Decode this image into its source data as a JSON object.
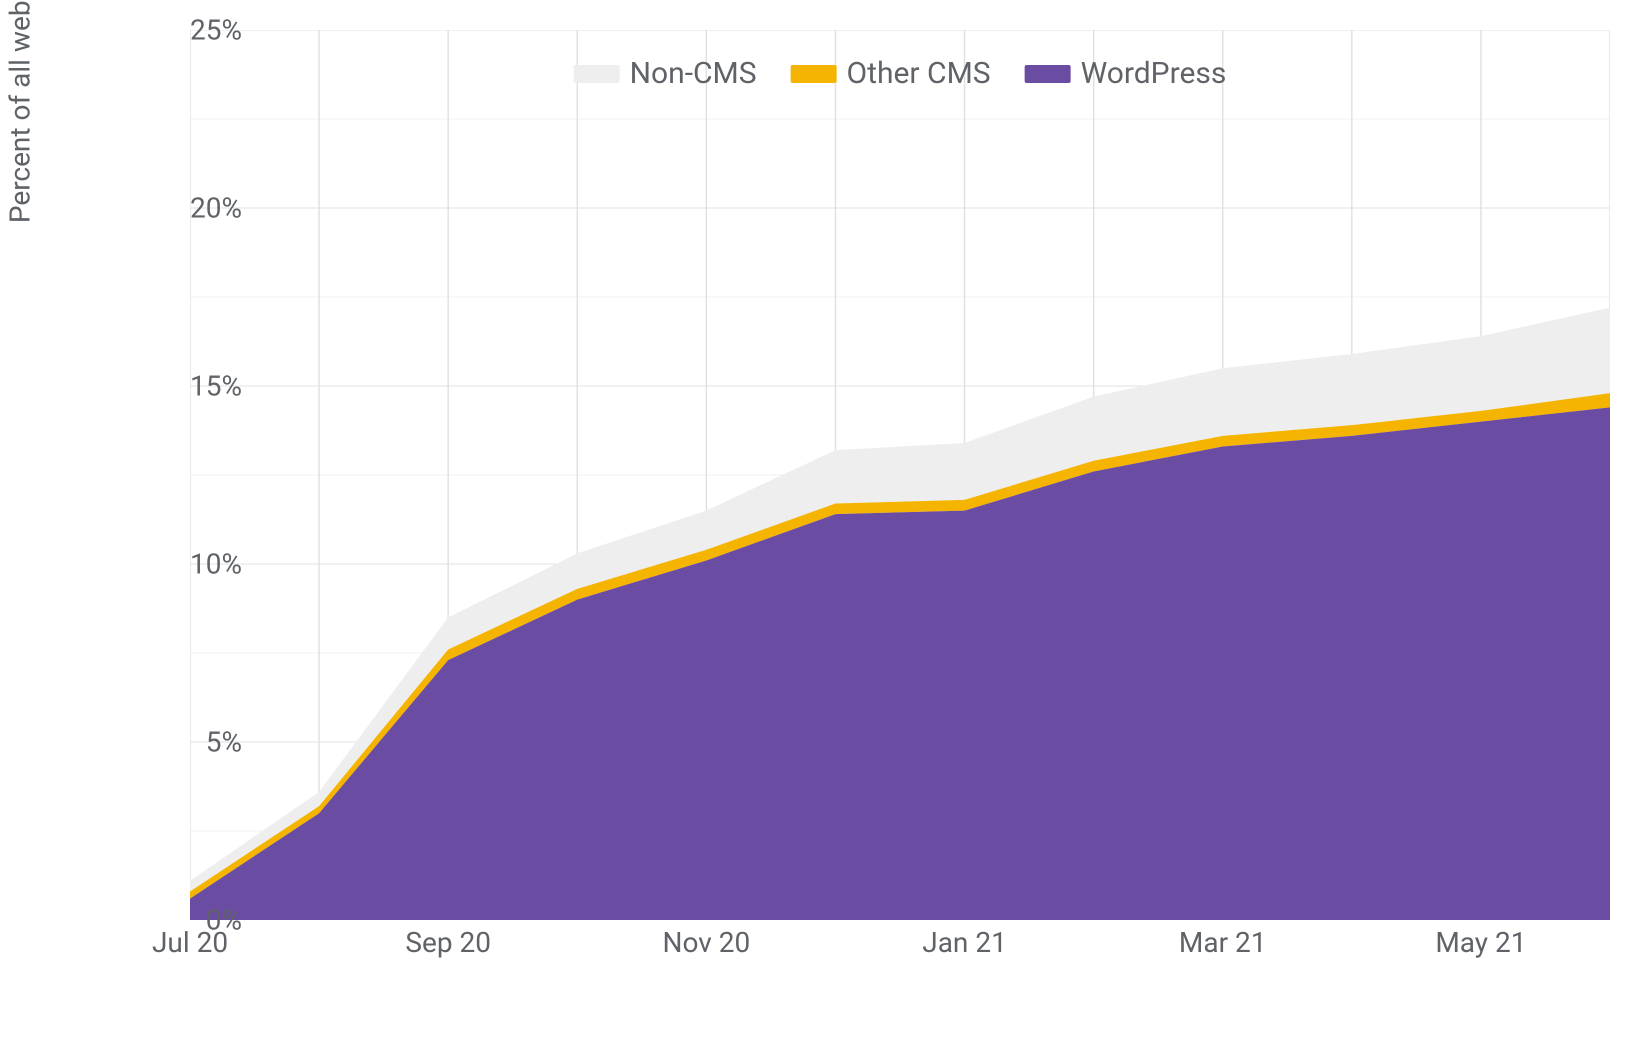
{
  "chart_data": {
    "type": "area",
    "ylabel": "Percent of all websites that use native lazy loading",
    "xlabel": "",
    "ylim": [
      0,
      25
    ],
    "yticks": [
      0,
      5,
      10,
      15,
      20,
      25
    ],
    "ytick_labels": [
      "0%",
      "5%",
      "10%",
      "15%",
      "20%",
      "25%"
    ],
    "x_categories": [
      "Jul 20",
      "Aug 20",
      "Sep 20",
      "Oct 20",
      "Nov 20",
      "Dec 20",
      "Jan 21",
      "Feb 21",
      "Mar 21",
      "Apr 21",
      "May 21",
      "Jun 21"
    ],
    "x_tick_labels_shown": [
      "Jul 20",
      "Sep 20",
      "Nov 20",
      "Jan 21",
      "Mar 21",
      "May 21"
    ],
    "x_tick_indices_shown": [
      0,
      2,
      4,
      6,
      8,
      10
    ],
    "series": [
      {
        "name": "WordPress",
        "color": "#6a4ca3",
        "values": [
          0.6,
          3.0,
          7.3,
          9.0,
          10.1,
          11.4,
          11.5,
          12.6,
          13.3,
          13.6,
          14.0,
          14.4
        ]
      },
      {
        "name": "Other CMS",
        "color": "#f5b400",
        "values": [
          0.2,
          0.2,
          0.3,
          0.3,
          0.3,
          0.3,
          0.3,
          0.3,
          0.3,
          0.3,
          0.3,
          0.4
        ]
      },
      {
        "name": "Non-CMS",
        "color": "#eeeeee",
        "values": [
          0.3,
          0.4,
          0.9,
          1.0,
          1.1,
          1.5,
          1.6,
          1.8,
          1.9,
          2.0,
          2.1,
          2.4
        ]
      }
    ],
    "legend_order": [
      "Non-CMS",
      "Other CMS",
      "WordPress"
    ],
    "stack_order_bottom_to_top": [
      "WordPress",
      "Other CMS",
      "Non-CMS"
    ]
  }
}
